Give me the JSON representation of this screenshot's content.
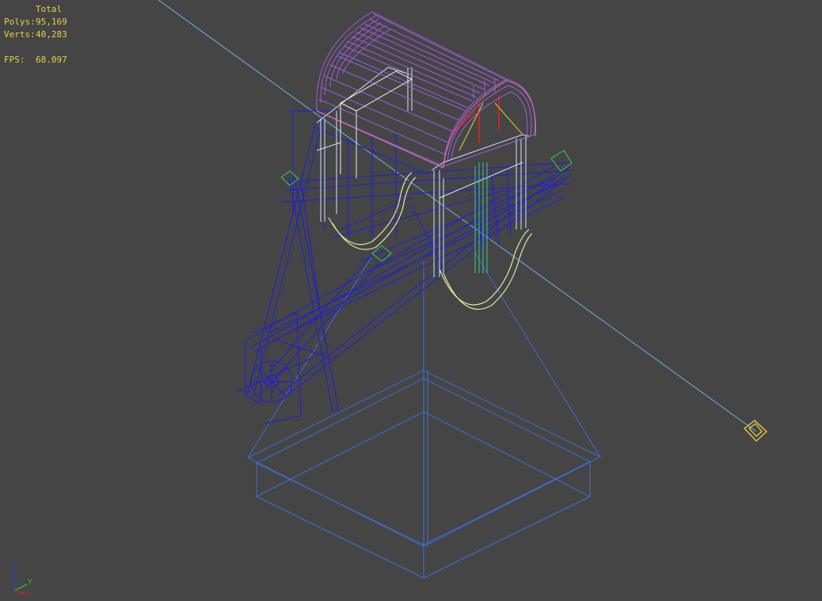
{
  "stats": {
    "title": "Total",
    "polys_label": "Polys:",
    "polys_value": "95,169",
    "verts_label": "Verts:",
    "verts_value": "40,283",
    "fps_label": "FPS:",
    "fps_value": "68.097"
  },
  "axis_gizmo": {
    "x_label": "x",
    "y_label": "y",
    "z_label": "z"
  },
  "colors": {
    "background": "#454545",
    "stats_text": "#e8d23a",
    "roof_wireframe": "#a05ae0",
    "frame_wireframe": "#2020c0",
    "base_wireframe": "#3a6fd8",
    "light_wireframe": "#e8d23a",
    "axis_x": "#d02020",
    "axis_y": "#20c020",
    "axis_z": "#2040d0"
  }
}
